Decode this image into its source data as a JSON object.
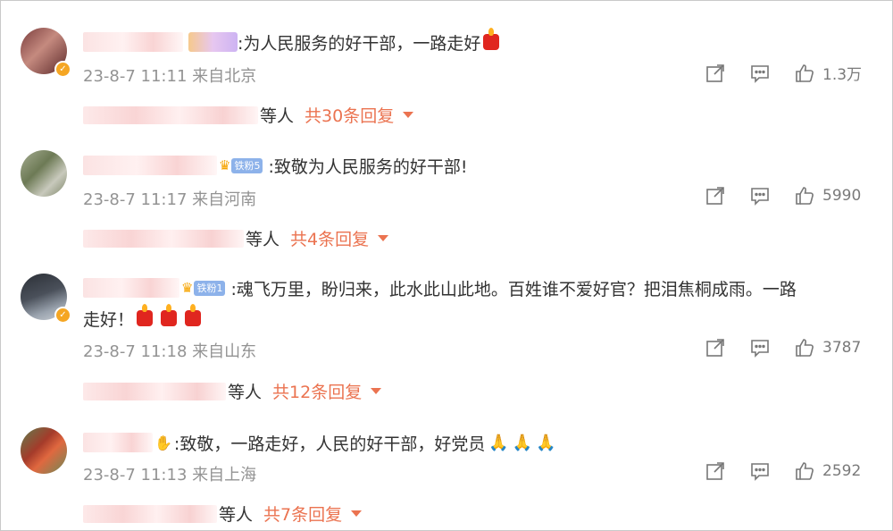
{
  "colors": {
    "link": "#eb7350",
    "meta": "#939393",
    "text": "#333333",
    "fan_badge": "#8db2ea"
  },
  "comments": [
    {
      "text": ":为人民服务的好干部，一路走好",
      "emojis": [
        "candle"
      ],
      "meta": "23-8-7 11:11 来自北京",
      "likes": "1.3万",
      "others": "等人",
      "total": "共30条回复",
      "verified": true,
      "fan_badge": ""
    },
    {
      "text": ":致敬为人民服务的好干部!",
      "emojis": [],
      "meta": "23-8-7 11:17 来自河南",
      "likes": "5990",
      "others": "等人",
      "total": "共4条回复",
      "verified": false,
      "fan_badge": "铁粉5"
    },
    {
      "text_line1": ":魂飞万里，盼归来，此水此山此地。百姓谁不爱好官？把泪焦桐成雨。一路",
      "text_line2": "走好！",
      "emojis": [
        "candle",
        "candle",
        "candle"
      ],
      "meta": "23-8-7 11:18 来自山东",
      "likes": "3787",
      "others": "等人",
      "total": "共12条回复",
      "verified": true,
      "fan_badge": "铁粉1"
    },
    {
      "text": ":致敬，一路走好，人民的好干部，好党员",
      "emojis": [
        "pray",
        "pray",
        "pray"
      ],
      "meta": "23-8-7 11:13 来自上海",
      "likes": "2592",
      "others": "等人",
      "total": "共7条回复",
      "verified": false,
      "fan_badge": ""
    }
  ],
  "icons": {
    "repost": "share-icon",
    "comment": "comment-icon",
    "like": "thumbs-up-icon"
  }
}
